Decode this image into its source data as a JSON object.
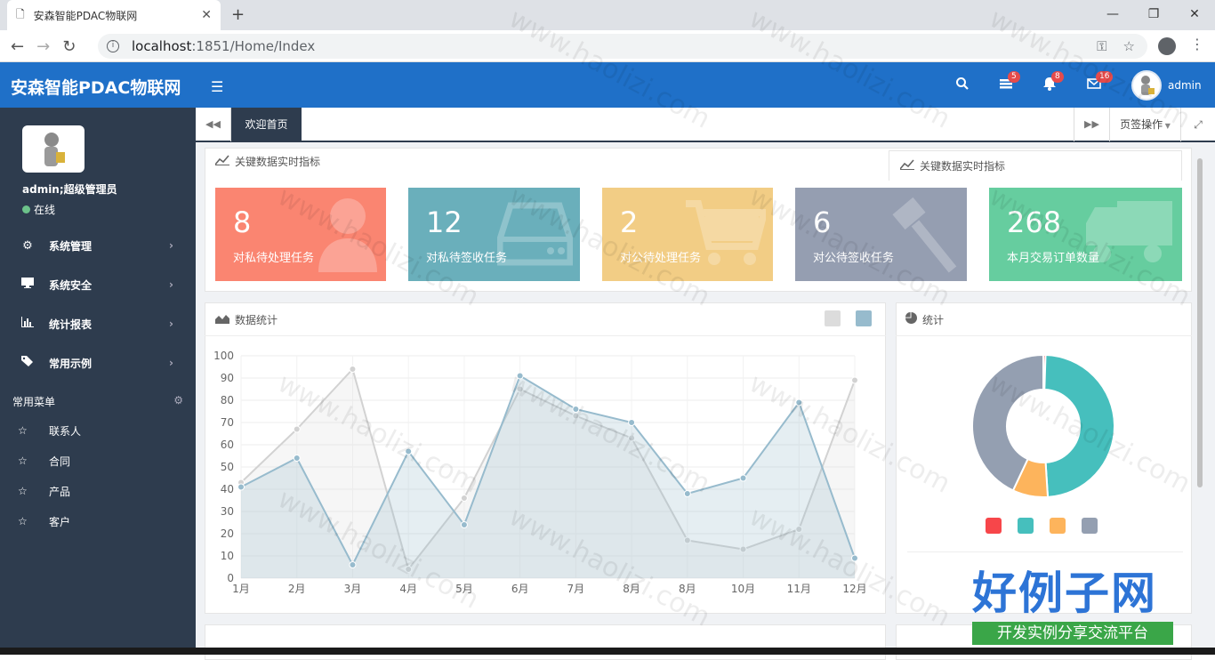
{
  "browser": {
    "tab_title": "安森智能PDAC物联网",
    "url_host": "localhost",
    "url_path": ":1851/Home/Index"
  },
  "header": {
    "logo": "安森智能PDAC物联网",
    "badges": {
      "tasks": "5",
      "notifications": "8",
      "messages": "16"
    },
    "username": "admin",
    "brand_color": "#1f70c8"
  },
  "sidebar": {
    "user": "admin;超级管理员",
    "status": "在线",
    "menu": [
      {
        "label": "系统管理",
        "icon": "gears-icon"
      },
      {
        "label": "系统安全",
        "icon": "desktop-icon"
      },
      {
        "label": "统计报表",
        "icon": "bar-chart-icon"
      },
      {
        "label": "常用示例",
        "icon": "tags-icon"
      }
    ],
    "favorites_title": "常用菜单",
    "favorites": [
      "联系人",
      "合同",
      "产品",
      "客户"
    ]
  },
  "tabbar": {
    "active_tab": "欢迎首页",
    "ops_label": "页签操作"
  },
  "kpi": {
    "title": "关键数据实时指标",
    "tab_label": "关键数据实时指标",
    "cards": [
      {
        "value": "8",
        "label": "对私待处理任务",
        "color": "#fa8571",
        "icon": "user-icon"
      },
      {
        "value": "12",
        "label": "对私待签收任务",
        "color": "#6aafbb",
        "icon": "hdd-icon"
      },
      {
        "value": "2",
        "label": "对公待处理任务",
        "color": "#f2cd85",
        "icon": "cart-icon"
      },
      {
        "value": "6",
        "label": "对公待签收任务",
        "color": "#959eb1",
        "icon": "gavel-icon"
      },
      {
        "value": "268",
        "label": "本月交易订单数量",
        "color": "#66cd9f",
        "icon": "truck-icon"
      }
    ]
  },
  "stats_panel": {
    "title": "数据统计"
  },
  "pie_panel": {
    "title": "统计"
  },
  "chart_data": [
    {
      "type": "area",
      "categories": [
        "1月",
        "2月",
        "3月",
        "4月",
        "5月",
        "6月",
        "7月",
        "8月",
        "8月",
        "10月",
        "11月",
        "12月"
      ],
      "ylim": [
        0,
        100
      ],
      "yticks": [
        0,
        10,
        20,
        30,
        40,
        50,
        60,
        70,
        80,
        90,
        100
      ],
      "grid": true,
      "series": [
        {
          "values": [
            43,
            67,
            94,
            4,
            36,
            85,
            73,
            63,
            17,
            13,
            22,
            89
          ],
          "color": "#d2d2d2"
        },
        {
          "values": [
            41,
            54,
            6,
            57,
            24,
            91,
            76,
            70,
            38,
            45,
            79,
            9
          ],
          "color": "#97bbcd"
        }
      ],
      "legend_colors": [
        "#dcdcdc",
        "#97bbcd"
      ]
    },
    {
      "type": "pie",
      "donut": true,
      "values": [
        0.5,
        48.5,
        8,
        43
      ],
      "colors": [
        "#f7464a",
        "#46bfbd",
        "#fdb45c",
        "#949fb1"
      ],
      "legend_colors": [
        "#f7464a",
        "#46bfbd",
        "#fdb45c",
        "#949fb1"
      ]
    }
  ],
  "watermark": {
    "text": "www.haolizi.com",
    "brand_big": "好例子网",
    "brand_small": "开发实例分享交流平台"
  }
}
